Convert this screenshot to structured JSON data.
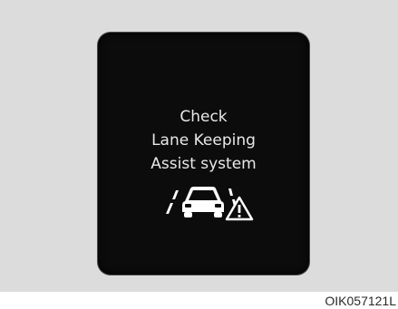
{
  "display": {
    "message_lines": [
      "Check",
      "Lane Keeping",
      "Assist system"
    ],
    "icon": "lane-keeping-assist-warning-icon",
    "text_color": "#e8e8e8",
    "screen_color": "#0c0c0c"
  },
  "figure_code": "OIK057121L"
}
